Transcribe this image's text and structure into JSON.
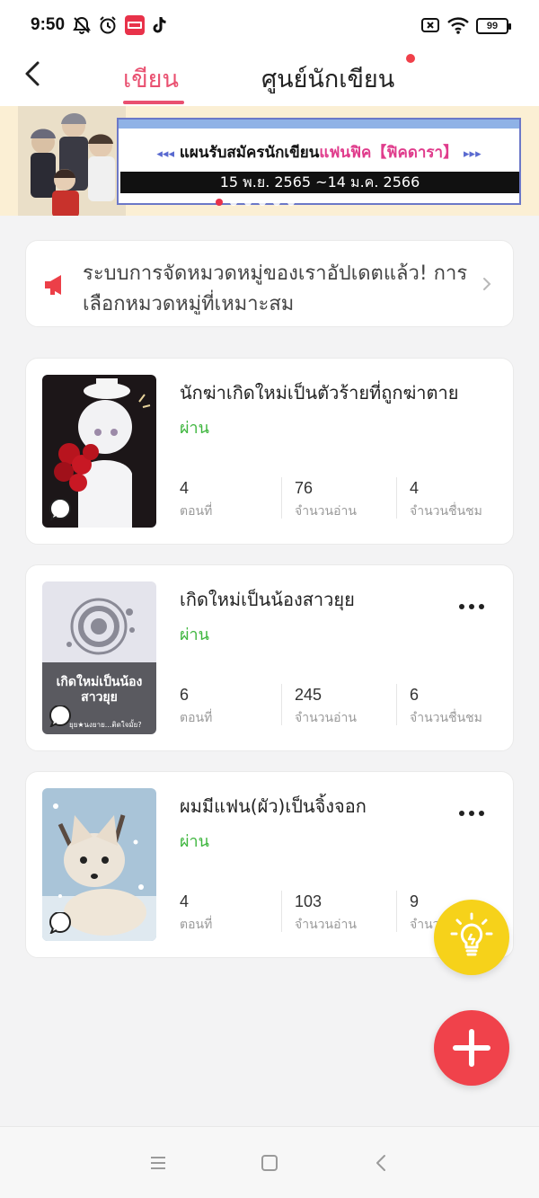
{
  "status_bar": {
    "time": "9:50",
    "battery": "99",
    "icons": [
      "notifications-off-icon",
      "alarm-icon",
      "mangatoon-app-icon",
      "tiktok-icon",
      "no-sim-icon",
      "wifi-icon",
      "battery-icon"
    ]
  },
  "header": {
    "back_icon": "back-arrow-icon",
    "tabs": [
      {
        "label": "เขียน",
        "active": true
      },
      {
        "label": "ศูนย์นักเขียน",
        "active": false,
        "has_notification_dot": true
      }
    ]
  },
  "banner": {
    "title_prefix": "แผนรับสมัครนักเขียน",
    "title_accent": "แฟนฟิค【ฟิคดารา】",
    "arrows_left": "◂◂◂",
    "arrows_right": "▸▸▸",
    "date_range": "15 พ.ย. 2565 ~14 ม.ค. 2566",
    "page_count": 6,
    "active_page": 1
  },
  "notice": {
    "icon": "megaphone-icon",
    "text": "ระบบการจัดหมวดหมู่ของเราอัปเดตแล้ว! การเลือกหมวดหมู่ที่เหมาะสม",
    "chevron": "chevron-right-icon"
  },
  "works": [
    {
      "title": "นักฆ่าเกิดใหม่เป็นตัวร้ายที่ถูกฆ่าตาย",
      "status": "ผ่าน",
      "cover_text": "",
      "stats": [
        {
          "value": "4",
          "label": "ตอนที่"
        },
        {
          "value": "76",
          "label": "จำนวนอ่าน"
        },
        {
          "value": "4",
          "label": "จำนวนชื่นชม"
        }
      ]
    },
    {
      "title": "เกิดใหม่เป็นน้องสาวยุย",
      "status": "ผ่าน",
      "cover_text": "เกิดใหม่เป็นน้องสาวยุย",
      "cover_subtext": "ยุย★นงยาย...ติดใจมั้ย?",
      "stats": [
        {
          "value": "6",
          "label": "ตอนที่"
        },
        {
          "value": "245",
          "label": "จำนวนอ่าน"
        },
        {
          "value": "6",
          "label": "จำนวนชื่นชม"
        }
      ]
    },
    {
      "title": "ผมมีแฟน(ผัว)เป็นจิ้งจอก",
      "status": "ผ่าน",
      "cover_text": "",
      "stats": [
        {
          "value": "4",
          "label": "ตอนที่"
        },
        {
          "value": "103",
          "label": "จำนวนอ่าน"
        },
        {
          "value": "9",
          "label": "จำนวนชื่นชม"
        }
      ]
    }
  ],
  "fab": {
    "idea_icon": "lightbulb-icon",
    "add_icon": "plus-icon"
  },
  "nav_bar": {
    "buttons": [
      "menu-icon",
      "home-square-icon",
      "back-triangle-icon"
    ]
  },
  "colors": {
    "accent": "#e95070",
    "status_pass": "#3cb53c",
    "fab_add": "#f0424b",
    "fab_idea": "#f6d21a"
  }
}
